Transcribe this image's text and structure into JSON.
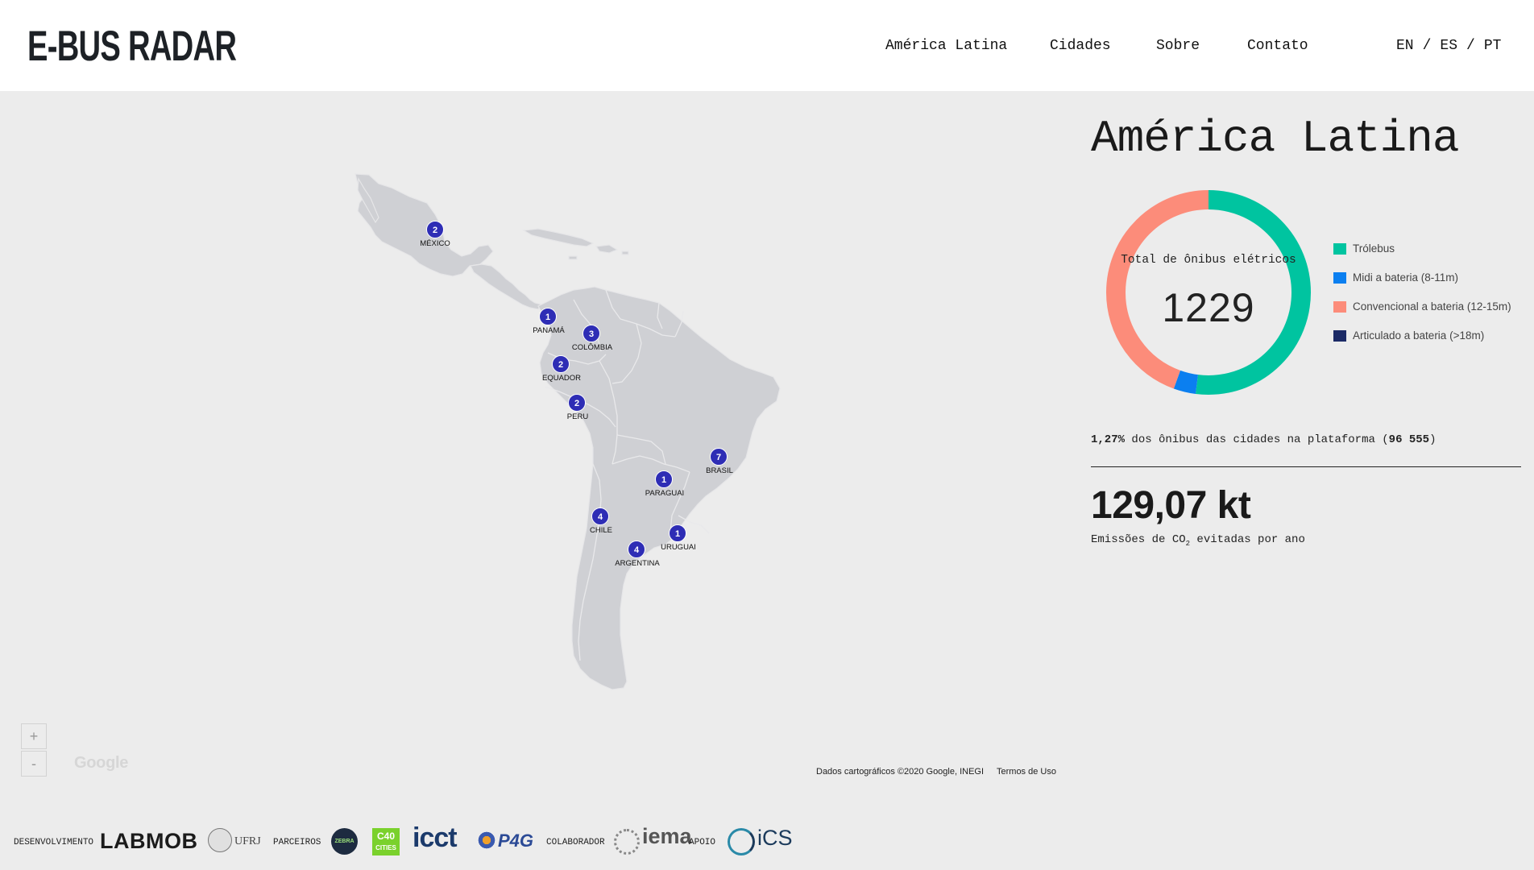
{
  "header": {
    "logo": "E-BUS RADAR",
    "nav": [
      "América Latina",
      "Cidades",
      "Sobre",
      "Contato"
    ],
    "languages": [
      "EN",
      "ES",
      "PT"
    ],
    "lang_sep": "/"
  },
  "map": {
    "markers": [
      {
        "count": "2",
        "label": "MÉXICO"
      },
      {
        "count": "1",
        "label": "PANAMÁ"
      },
      {
        "count": "3",
        "label": "COLÔMBIA"
      },
      {
        "count": "2",
        "label": "EQUADOR"
      },
      {
        "count": "2",
        "label": "PERU"
      },
      {
        "count": "7",
        "label": "BRASIL"
      },
      {
        "count": "1",
        "label": "PARAGUAI"
      },
      {
        "count": "4",
        "label": "CHILE"
      },
      {
        "count": "1",
        "label": "URUGUAI"
      },
      {
        "count": "4",
        "label": "ARGENTINA"
      }
    ],
    "zoom_in": "+",
    "zoom_out": "-",
    "google_logo": "Google",
    "attribution": "Dados cartográficos ©2020 Google, INEGI",
    "terms": "Termos de Uso"
  },
  "panel": {
    "title": "América Latina",
    "donut": {
      "label": "Total de ônibus elétricos",
      "total": "1229",
      "segments": [
        {
          "name": "Trólebus",
          "fraction": 0.52,
          "color": "#00c4a0"
        },
        {
          "name": "Midi a bateria (8-11m)",
          "fraction": 0.035,
          "color": "#0b7ff0"
        },
        {
          "name": "Convencional a bateria (12-15m)",
          "fraction": 0.445,
          "color": "#fc8c7a"
        },
        {
          "name": "Articulado a bateria (>18m)",
          "fraction": 0.0,
          "color": "#1b2a66"
        }
      ]
    },
    "share": {
      "percent": "1,27%",
      "text": " dos ônibus das cidades na plataforma (",
      "count": "96 555",
      "close": ")"
    },
    "emissions": {
      "value": "129,07 kt",
      "label_pre": "Emissões de CO",
      "label_sub": "2",
      "label_post": " evitadas por ano"
    }
  },
  "footer": {
    "cat_dev": "DESENVOLVIMENTO",
    "labmob": "LABMOB",
    "ufrj": "UFRJ",
    "cat_partners": "PARCEIROS",
    "zebra": "ZEBRA",
    "c40": "C40",
    "c40_sub": "CITIES",
    "icct": "icct",
    "p4g": "P4G",
    "cat_collab": "COLABORADOR",
    "iema": "iema",
    "cat_support": "APOIO",
    "ics": "iCS"
  }
}
